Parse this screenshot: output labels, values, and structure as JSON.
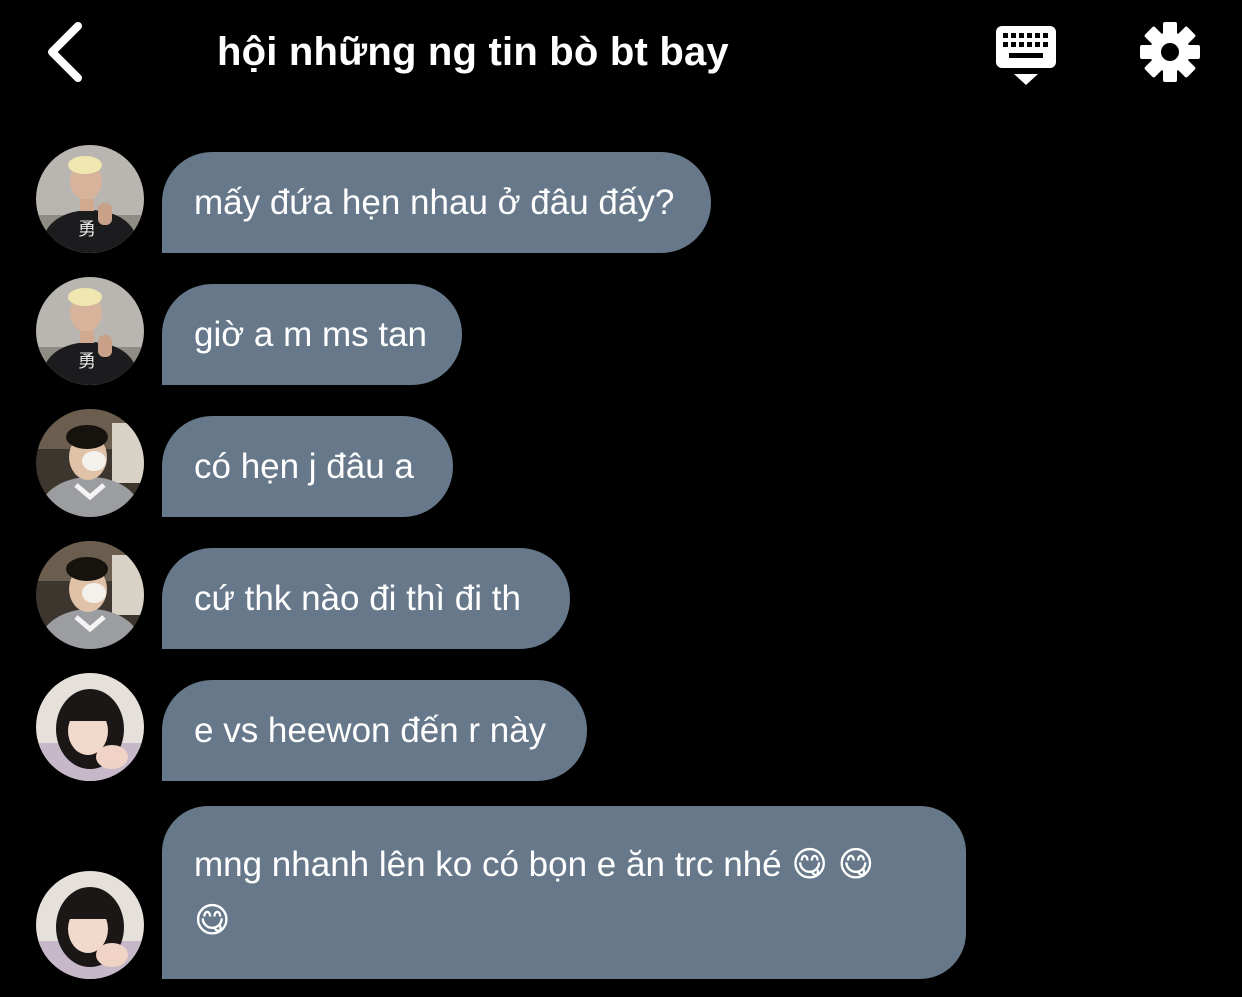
{
  "header": {
    "title": "hội những ng tin bò bt bay",
    "back_icon": "chevron-left-icon",
    "keyboard_icon": "keyboard-icon",
    "settings_icon": "gear-icon"
  },
  "colors": {
    "background": "#000000",
    "bubble": "#66788a",
    "text": "#ffffff"
  },
  "messages": [
    {
      "sender_avatar": "avatar-blonde-man",
      "text": "mấy đứa hẹn nhau ở đâu đấy?"
    },
    {
      "sender_avatar": "avatar-blonde-man",
      "text": "giờ a m ms tan"
    },
    {
      "sender_avatar": "avatar-boy-hoodie",
      "text": "có hẹn j đâu a"
    },
    {
      "sender_avatar": "avatar-boy-hoodie",
      "text": "cứ thk nào đi thì đi th"
    },
    {
      "sender_avatar": "avatar-girl",
      "text": "e vs heewon đến r này"
    },
    {
      "sender_avatar": "avatar-girl",
      "text": "mng nhanh lên ko có bọn e ăn trc nhé 😋 😋 😋"
    }
  ]
}
